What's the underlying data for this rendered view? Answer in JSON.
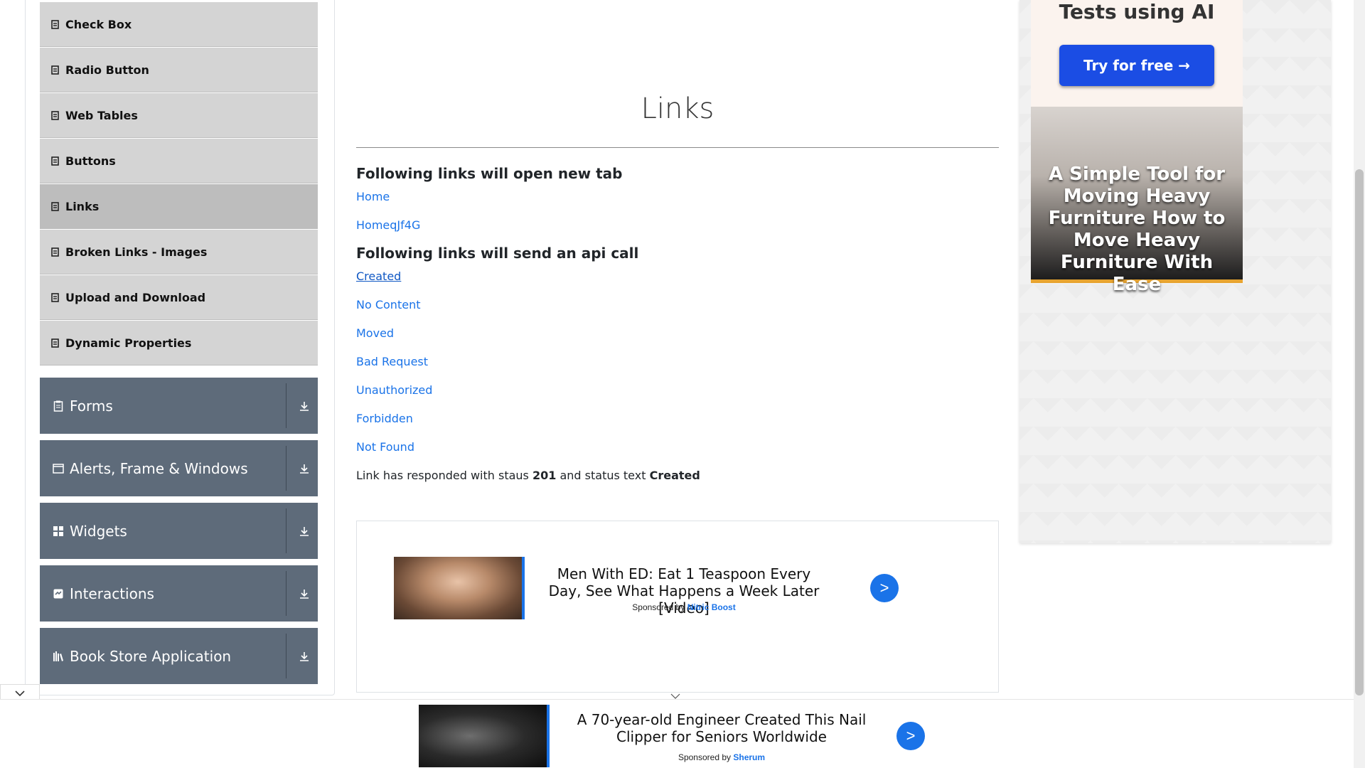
{
  "sidebar": {
    "items": [
      {
        "label": "Check Box",
        "icon": "file-icon"
      },
      {
        "label": "Radio Button",
        "icon": "file-icon"
      },
      {
        "label": "Web Tables",
        "icon": "file-icon"
      },
      {
        "label": "Buttons",
        "icon": "file-icon"
      },
      {
        "label": "Links",
        "icon": "file-icon",
        "active": true
      },
      {
        "label": "Broken Links - Images",
        "icon": "file-icon"
      },
      {
        "label": "Upload and Download",
        "icon": "file-icon"
      },
      {
        "label": "Dynamic Properties",
        "icon": "file-icon"
      }
    ],
    "groups": [
      {
        "label": "Forms",
        "icon": "clipboard-icon"
      },
      {
        "label": "Alerts, Frame & Windows",
        "icon": "window-icon"
      },
      {
        "label": "Widgets",
        "icon": "grid-icon"
      },
      {
        "label": "Interactions",
        "icon": "move-icon"
      },
      {
        "label": "Book Store Application",
        "icon": "books-icon"
      }
    ]
  },
  "main": {
    "title": "Links",
    "new_tab_heading": "Following links will open new tab",
    "new_tab_links": [
      "Home",
      "HomeqJf4G"
    ],
    "api_heading": "Following links will send an api call",
    "api_links": [
      "Created",
      "No Content",
      "Moved",
      "Bad Request",
      "Unauthorized",
      "Forbidden",
      "Not Found"
    ],
    "response": {
      "prefix": "Link has responded with staus",
      "status": "201",
      "middle": "and status text",
      "status_text": "Created"
    }
  },
  "inline_ad": {
    "headline": "Men With ED: Eat 1 Teaspoon Every Day, See What Happens a Week Later [Video]",
    "sponsored_prefix": "Sponsored by",
    "sponsor": "Nitric Boost",
    "go": ">"
  },
  "right_ad": {
    "top_text": "Tests using AI",
    "button": "Try for free →",
    "image_text": "A Simple Tool for Moving Heavy Furniture How to Move Heavy Furniture With Ease"
  },
  "bottom_ad": {
    "headline": "A 70-year-old Engineer Created This Nail Clipper for Seniors Worldwide",
    "sponsored_prefix": "Sponsored by",
    "sponsor": "Sherum",
    "go": ">"
  },
  "colors": {
    "link": "#1a73e8",
    "menu_bg": "#d4d4d4",
    "group_bg": "#5e6b7a",
    "cta": "#1b4de4"
  }
}
